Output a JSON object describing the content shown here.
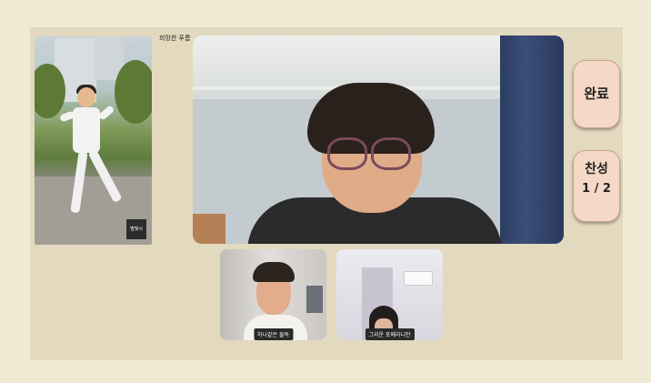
{
  "main_speaker": {
    "name": "희망찬 푸름"
  },
  "side_video": {
    "watermark": "별빛시"
  },
  "actions": {
    "done_label": "완료",
    "vote_label": "찬성",
    "vote_count": "1 / 2"
  },
  "participants": [
    {
      "name": "하나같은 물독"
    },
    {
      "name": "그리운 포메라니안"
    }
  ]
}
